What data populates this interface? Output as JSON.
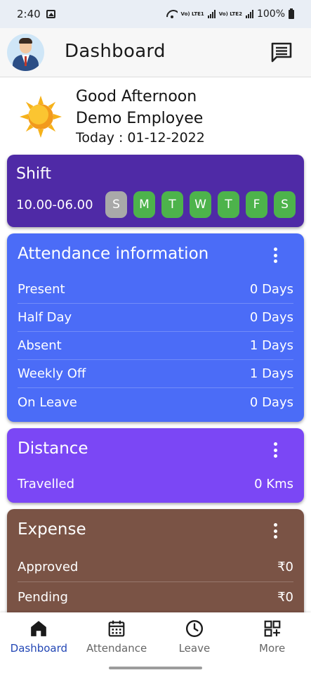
{
  "status_bar": {
    "time": "2:40",
    "battery": "100%",
    "sim1": "Vo) LTE1",
    "sim2": "Vo) LTE2",
    "icons": [
      "gallery-icon",
      "wifi-icon",
      "signal-icon",
      "battery-icon"
    ]
  },
  "app_bar": {
    "title": "Dashboard",
    "avatar_icon": "employee-avatar",
    "action_icon": "chat-icon"
  },
  "greeting": {
    "line1": "Good Afternoon",
    "line2": "Demo Employee",
    "date_text": "Today : 01-12-2022",
    "icon": "sun-icon"
  },
  "shift": {
    "title": "Shift",
    "time": "10.00-06.00",
    "days": [
      {
        "label": "S",
        "working": false
      },
      {
        "label": "M",
        "working": true
      },
      {
        "label": "T",
        "working": true
      },
      {
        "label": "W",
        "working": true
      },
      {
        "label": "T",
        "working": true
      },
      {
        "label": "F",
        "working": true
      },
      {
        "label": "S",
        "working": true
      }
    ],
    "colors": {
      "card": "#4f2aa6",
      "working": "#4db34b",
      "off": "#a9a9a9"
    }
  },
  "attendance": {
    "title": "Attendance information",
    "rows": [
      {
        "label": "Present",
        "value": "0 Days"
      },
      {
        "label": "Half Day",
        "value": "0 Days"
      },
      {
        "label": "Absent",
        "value": "1 Days"
      },
      {
        "label": "Weekly Off",
        "value": "1 Days"
      },
      {
        "label": "On Leave",
        "value": "0 Days"
      }
    ],
    "color": "#4b6cf7"
  },
  "distance": {
    "title": "Distance",
    "rows": [
      {
        "label": "Travelled",
        "value": "0 Kms"
      }
    ],
    "color": "#7b47f5"
  },
  "expense": {
    "title": "Expense",
    "rows": [
      {
        "label": "Approved",
        "value": "₹0"
      },
      {
        "label": "Pending",
        "value": "₹0"
      }
    ],
    "color": "#7a5345"
  },
  "bottom_nav": {
    "items": [
      {
        "label": "Dashboard",
        "icon": "home-icon",
        "active": true
      },
      {
        "label": "Attendance",
        "icon": "calendar-icon",
        "active": false
      },
      {
        "label": "Leave",
        "icon": "clock-icon",
        "active": false
      },
      {
        "label": "More",
        "icon": "grid-plus-icon",
        "active": false
      }
    ],
    "active_color": "#2347b5"
  }
}
